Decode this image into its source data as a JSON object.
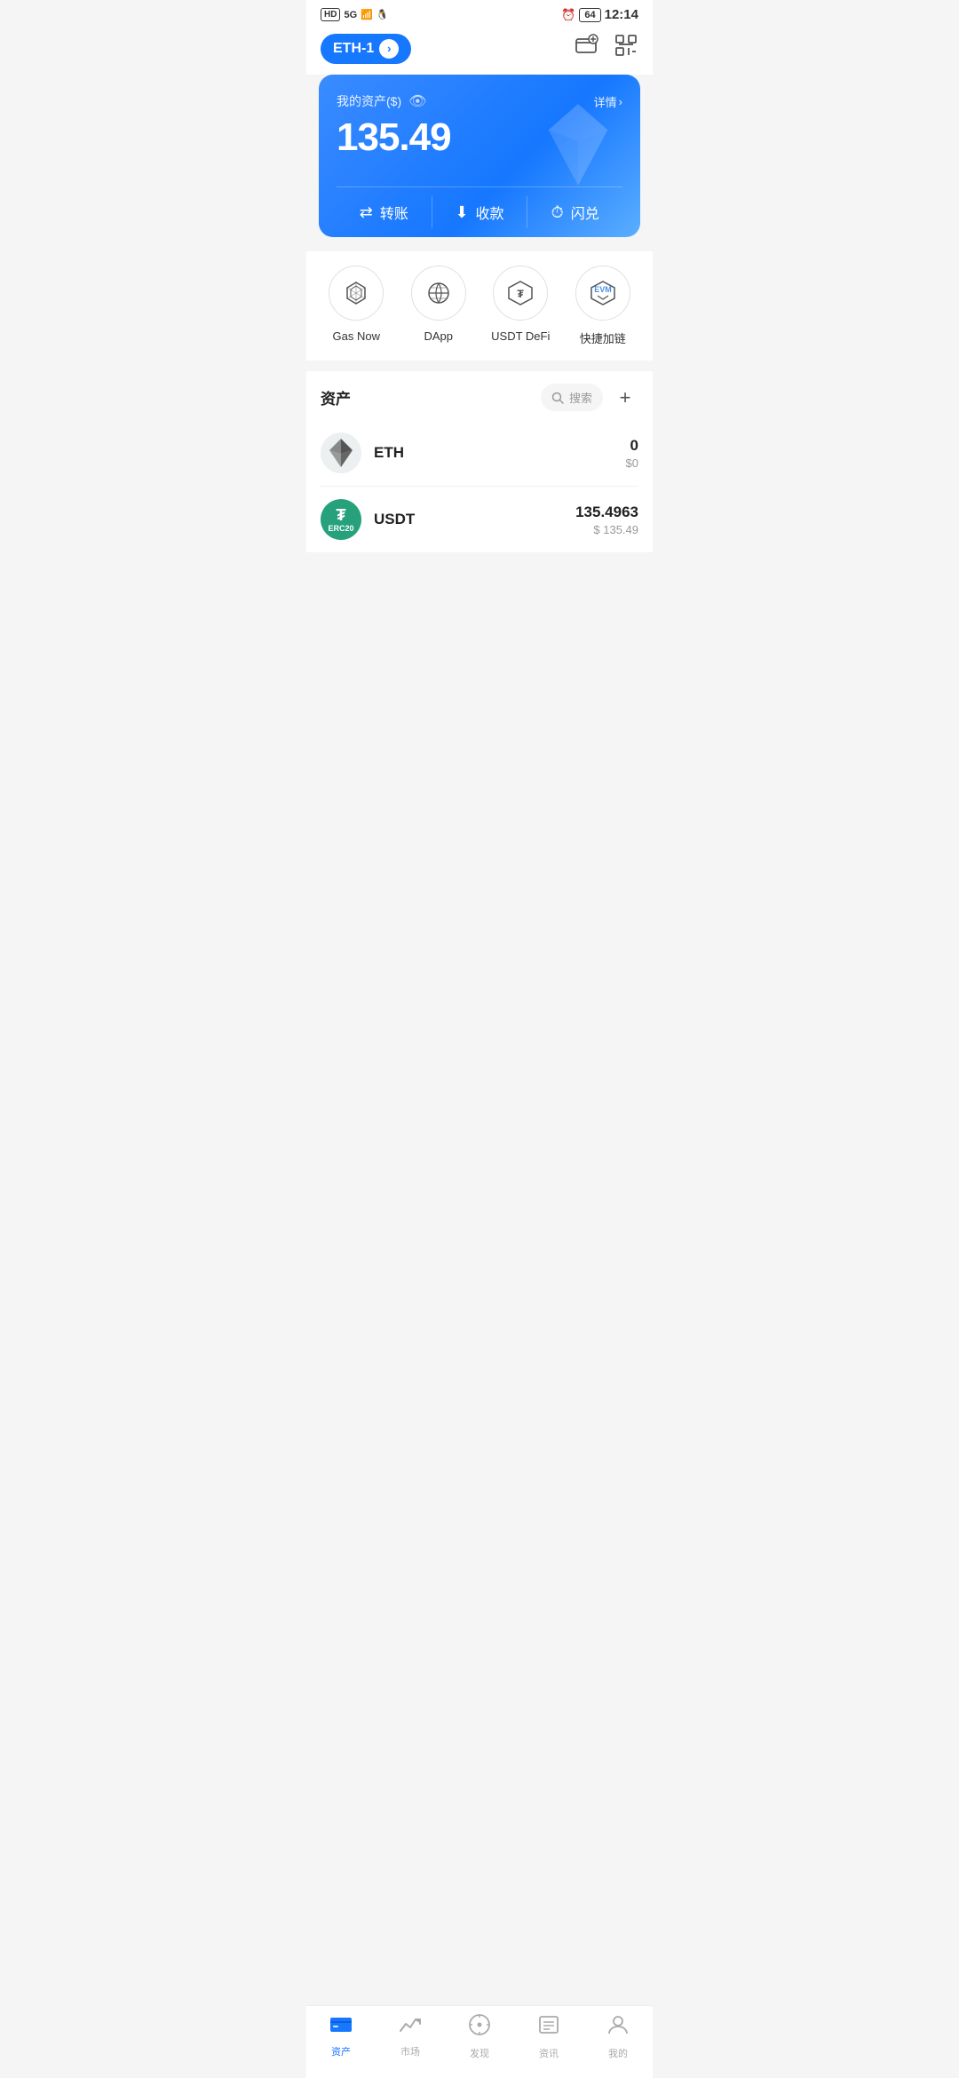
{
  "statusBar": {
    "left": [
      "HD",
      "5G",
      "📶",
      "🐧"
    ],
    "time": "12:14",
    "battery": "64"
  },
  "header": {
    "network": "ETH-1",
    "walletIcon": "wallet",
    "scanIcon": "scan"
  },
  "assetCard": {
    "label": "我的资产($)",
    "detailLabel": "详情",
    "amount": "135.49",
    "actions": [
      {
        "key": "transfer",
        "icon": "⇄",
        "label": "转账"
      },
      {
        "key": "receive",
        "icon": "↓",
        "label": "收款"
      },
      {
        "key": "flash",
        "icon": "⊙",
        "label": "闪兑"
      }
    ]
  },
  "quickLinks": [
    {
      "key": "gas-now",
      "label": "Gas Now"
    },
    {
      "key": "dapp",
      "label": "DApp"
    },
    {
      "key": "usdt-defi",
      "label": "USDT DeFi"
    },
    {
      "key": "quick-chain",
      "label": "快捷加链"
    }
  ],
  "assetsSection": {
    "title": "资产",
    "searchPlaceholder": "搜索",
    "addLabel": "+",
    "assets": [
      {
        "symbol": "ETH",
        "name": "ETH",
        "balance": "0",
        "usdValue": "$0"
      },
      {
        "symbol": "USDT",
        "name": "USDT",
        "balance": "135.4963",
        "usdValue": "$ 135.49"
      }
    ]
  },
  "bottomNav": [
    {
      "key": "assets",
      "label": "资产",
      "active": true
    },
    {
      "key": "market",
      "label": "市场",
      "active": false
    },
    {
      "key": "discover",
      "label": "发现",
      "active": false
    },
    {
      "key": "news",
      "label": "资讯",
      "active": false
    },
    {
      "key": "profile",
      "label": "我的",
      "active": false
    }
  ]
}
